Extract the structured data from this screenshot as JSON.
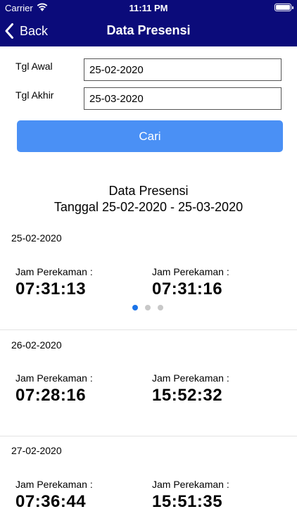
{
  "status_bar": {
    "carrier": "Carrier",
    "time": "11:11 PM"
  },
  "nav": {
    "back_label": "Back",
    "title": "Data Presensi",
    "bar_color": "#0b0b7a"
  },
  "form": {
    "start_label": "Tgl Awal",
    "start_value": "25-02-2020",
    "end_label": "Tgl Akhir",
    "end_value": "25-03-2020",
    "search_label": "Cari",
    "button_color": "#4a90f5"
  },
  "report": {
    "title_line1": "Data Presensi",
    "title_line2": "Tanggal 25-02-2020 - 25-03-2020"
  },
  "days": [
    {
      "date": "25-02-2020",
      "records": [
        {
          "label": "Jam Perekaman :",
          "time": "07:31:13"
        },
        {
          "label": "Jam Perekaman :",
          "time": "07:31:16"
        }
      ],
      "pager": {
        "pages": 3,
        "active": 1
      }
    },
    {
      "date": "26-02-2020",
      "records": [
        {
          "label": "Jam Perekaman :",
          "time": "07:28:16"
        },
        {
          "label": "Jam Perekaman :",
          "time": "15:52:32"
        }
      ]
    },
    {
      "date": "27-02-2020",
      "records": [
        {
          "label": "Jam Perekaman :",
          "time": "07:36:44"
        },
        {
          "label": "Jam Perekaman :",
          "time": "15:51:35"
        }
      ]
    }
  ]
}
